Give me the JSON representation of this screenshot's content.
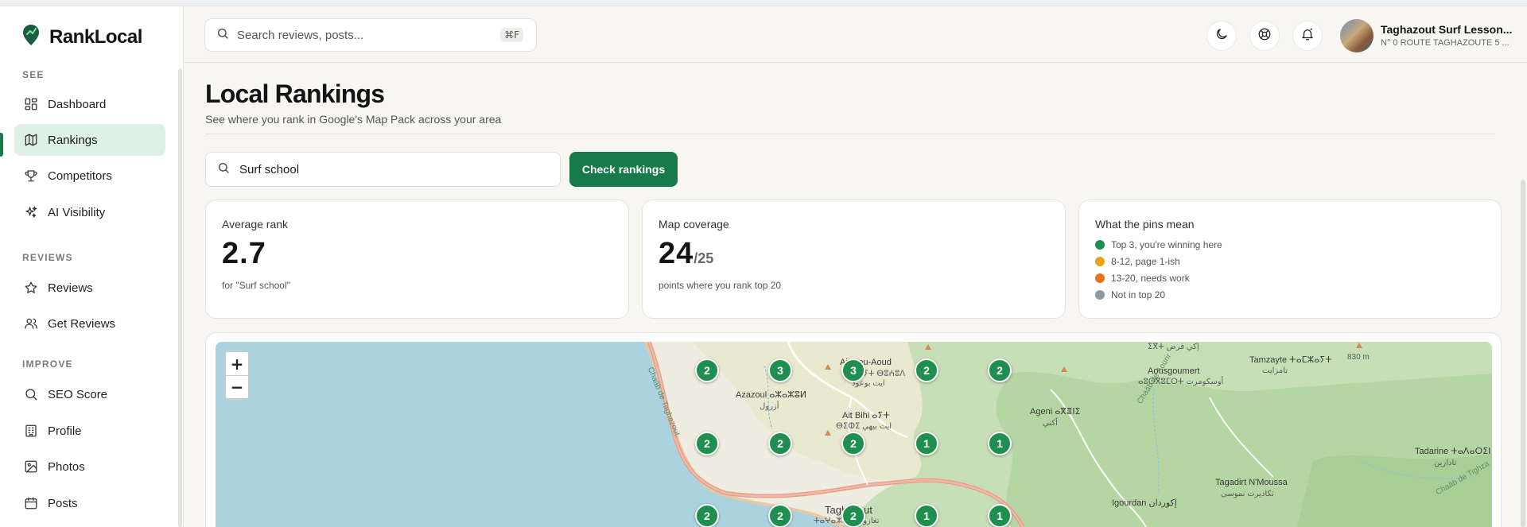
{
  "app": {
    "name": "RankLocal"
  },
  "sidebar": {
    "sections": [
      {
        "label": "SEE"
      },
      {
        "label": "REVIEWS"
      },
      {
        "label": "IMPROVE"
      }
    ],
    "items": [
      {
        "label": "Dashboard",
        "icon": "dashboard-icon"
      },
      {
        "label": "Rankings",
        "icon": "map-icon"
      },
      {
        "label": "Competitors",
        "icon": "trophy-icon"
      },
      {
        "label": "AI Visibility",
        "icon": "sparkles-icon"
      },
      {
        "label": "Reviews",
        "icon": "star-icon"
      },
      {
        "label": "Get Reviews",
        "icon": "users-icon"
      },
      {
        "label": "SEO Score",
        "icon": "search-icon"
      },
      {
        "label": "Profile",
        "icon": "building-icon"
      },
      {
        "label": "Photos",
        "icon": "image-icon"
      },
      {
        "label": "Posts",
        "icon": "calendar-icon"
      }
    ],
    "active": "Rankings"
  },
  "header": {
    "search_placeholder": "Search reviews, posts...",
    "shortcut": "⌘F",
    "business_name": "Taghazout Surf Lesson...",
    "business_address": "N° 0 ROUTE TAGHAZOUTE 5 ..."
  },
  "page": {
    "title": "Local Rankings",
    "subtitle": "See where you rank in Google's Map Pack across your area"
  },
  "keyword": {
    "value": "Surf school",
    "button_label": "Check rankings"
  },
  "stats": {
    "average_rank": {
      "label": "Average rank",
      "value": "2.7",
      "note": "for \"Surf school\""
    },
    "coverage": {
      "label": "Map coverage",
      "value": "24",
      "total": "/25",
      "note": "points where you rank top 20"
    }
  },
  "legend": {
    "title": "What the pins mean",
    "items": [
      {
        "label": "Top 3, you're winning here",
        "color": "#1e8f4f"
      },
      {
        "label": "8-12, page 1-ish",
        "color": "#e8a317"
      },
      {
        "label": "13-20, needs work",
        "color": "#e8731a"
      },
      {
        "label": "Not in top 20",
        "color": "#8e9aa6"
      }
    ]
  },
  "map": {
    "zoom_in": "+",
    "zoom_out": "−",
    "pins": [
      "2",
      "3",
      "3",
      "2",
      "2",
      "2",
      "2",
      "2",
      "1",
      "1",
      "2",
      "2",
      "2",
      "1",
      "1"
    ],
    "places": [
      "Ait Bou-Aoud",
      "Azazoul ⴰⵣⴰⵣⵓⵍ",
      "أزرول",
      "ⴰⵢⵜ ⴱⵓⵄⵓⴷ",
      "ايت بوعود",
      "Ait Bihi ⴰⵢⵜ",
      "ⴱⵉⵀⵉ ايت بيهي",
      "Ageni ⴰⴳⴻⵏⵉ",
      "أكني",
      "Aousgoumert",
      "ⴰⵓⵙⴳⵓⵎⵔⵜ أوسكومرت",
      "Tamzayte ⵜⴰⵎⵣⴰⵢⵜ",
      "تامزايت",
      "ⵉⴳⵜ إكي فرض",
      "830 m",
      "Tadarine ⵜⴰⴷⴰⵔⵉⵏ",
      "تادارين",
      "Tagadirt N'Moussa",
      "تكاديرت نموسى",
      "Igourdan إكوردان",
      "Taghazout",
      "ⵜⴰⵖⴰⵣⵓⵜ تغازوت",
      "Chaâb de Taghazout",
      "Chaâb de Aourir",
      "Chaâb de Tighza"
    ]
  }
}
